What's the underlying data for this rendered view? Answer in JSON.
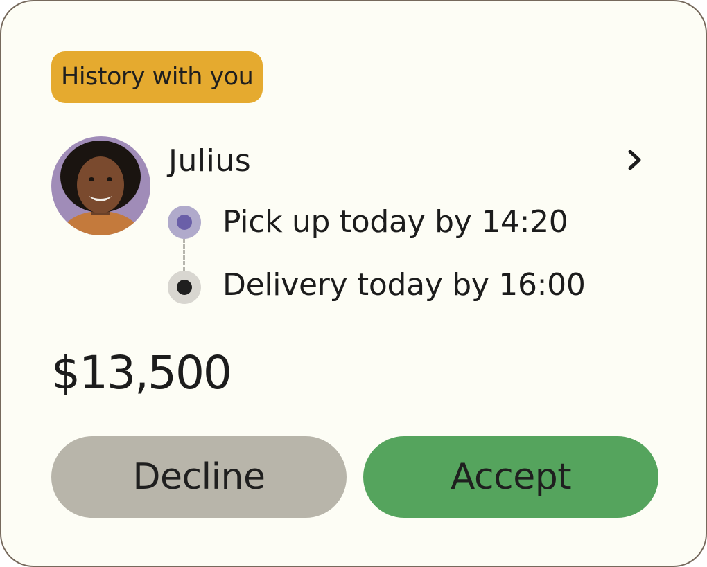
{
  "badge": {
    "label": "History with you"
  },
  "courier": {
    "name": "Julius",
    "avatar_icon": "person-photo"
  },
  "route": {
    "pickup": "Pick up today by 14:20",
    "delivery": "Delivery today by 16:00"
  },
  "price": "$13,500",
  "actions": {
    "decline_label": "Decline",
    "accept_label": "Accept"
  },
  "colors": {
    "badge": "#e5aa2f",
    "accept": "#55a45d",
    "decline": "#b8b5aa",
    "pickup_dot": "#6a5fa8",
    "card_border": "#76695c"
  },
  "icons": {
    "chevron": "chevron-right-icon"
  }
}
